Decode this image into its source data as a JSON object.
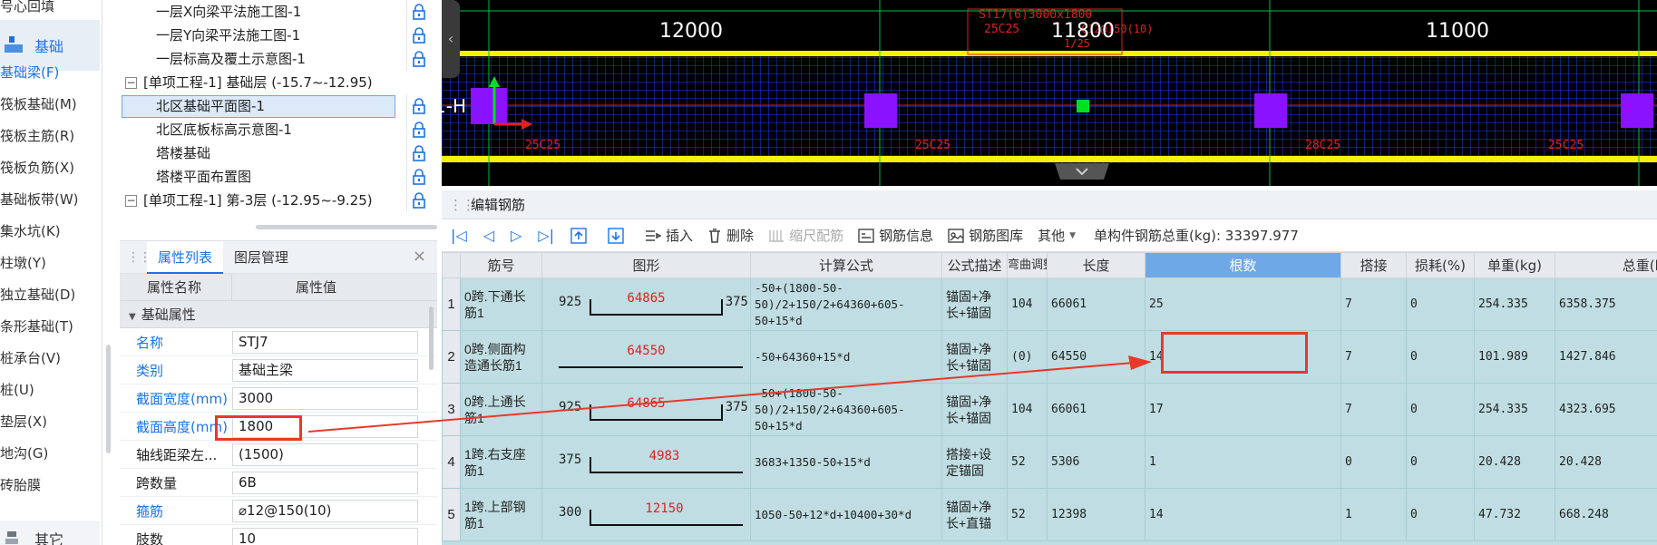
{
  "sidebar": {
    "items": [
      {
        "label": "号心回填"
      },
      {
        "label": "基础梁(F)",
        "active": true
      },
      {
        "label": "筏板基础(M)"
      },
      {
        "label": "筏板主筋(R)"
      },
      {
        "label": "筏板负筋(X)"
      },
      {
        "label": "基础板带(W)"
      },
      {
        "label": "集水坑(K)"
      },
      {
        "label": "柱墩(Y)"
      },
      {
        "label": "独立基础(D)"
      },
      {
        "label": "条形基础(T)"
      },
      {
        "label": "桩承台(V)"
      },
      {
        "label": "桩(U)"
      },
      {
        "label": "垫层(X)"
      },
      {
        "label": "地沟(G)"
      },
      {
        "label": "砖胎膜"
      }
    ],
    "group_foundation": "基础",
    "group_other": "其它"
  },
  "tree": {
    "rows": [
      {
        "label": "一层X向梁平法施工图-1",
        "indent": 1
      },
      {
        "label": "一层Y向梁平法施工图-1",
        "indent": 1
      },
      {
        "label": "一层标高及覆土示意图-1",
        "indent": 1
      },
      {
        "label": "[单项工程-1] 基础层 (-15.7~-12.95)",
        "indent": 0,
        "expander": "−"
      },
      {
        "label": "北区基础平面图-1",
        "indent": 1,
        "selected": true
      },
      {
        "label": "北区底板标高示意图-1",
        "indent": 1
      },
      {
        "label": "塔楼基础",
        "indent": 1
      },
      {
        "label": "塔楼平面布置图",
        "indent": 1
      },
      {
        "label": "[单项工程-1] 第-3层 (-12.95~-9.25)",
        "indent": 0,
        "expander": "−"
      }
    ]
  },
  "props": {
    "tab_active": "属性列表",
    "tab_inactive": "图层管理",
    "close": "×",
    "head_name": "属性名称",
    "head_value": "属性值",
    "group": "基础属性",
    "rows": [
      {
        "name": "名称",
        "value": "STJ7",
        "blue": true
      },
      {
        "name": "类别",
        "value": "基础主梁",
        "blue": true
      },
      {
        "name": "截面宽度(mm)",
        "value": "3000",
        "blue": true
      },
      {
        "name": "截面高度(mm)",
        "value": "1800",
        "blue": true
      },
      {
        "name": "轴线距梁左...",
        "value": "(1500)",
        "blue": false
      },
      {
        "name": "跨数量",
        "value": "6B",
        "blue": false
      },
      {
        "name": "箍筋",
        "value": "⌀12@150(10)",
        "blue": true
      },
      {
        "name": "肢数",
        "value": "10",
        "blue": false
      }
    ]
  },
  "cad": {
    "dims": [
      "12000",
      "11800",
      "11000"
    ],
    "axis_label": "1-H",
    "annotation_top": "ST17(6)3000x1800",
    "annotation_mid": "25C25",
    "annotation_mid2": "C12@150(10)",
    "annotation_mid3": "1/25",
    "beam_labels": [
      "25C25",
      "25C25",
      "28C25",
      "25C25"
    ]
  },
  "editor": {
    "title": "编辑钢筋",
    "toolbar": {
      "insert": "插入",
      "delete": "删除",
      "scale_rebar": "缩尺配筋",
      "rebar_info": "钢筋信息",
      "rebar_lib": "钢筋图库",
      "other": "其他",
      "total": "单构件钢筋总重(kg): 33397.977"
    },
    "columns": [
      "",
      "筋号",
      "图形",
      "计算公式",
      "公式描述",
      "弯曲调整",
      "长度",
      "根数",
      "搭接",
      "损耗(%)",
      "单重(kg)",
      "总重(k"
    ],
    "rows": [
      {
        "idx": "1",
        "name": "0跨.下通长筋1",
        "shape_left": "925",
        "shape_mid": "64865",
        "shape_right": "375",
        "shape_type": "u",
        "formula": "-50+(1800-50-50)/2+150/2+64360+605-50+15*d",
        "desc": "锚固+净长+锚固",
        "bend": "104",
        "length": "66061",
        "count": "25",
        "lap": "7",
        "loss": "0",
        "unit": "254.335",
        "total": "6358.375"
      },
      {
        "idx": "2",
        "name": "0跨.侧面构造通长筋1",
        "shape_left": "",
        "shape_mid": "64550",
        "shape_right": "",
        "shape_type": "flat",
        "formula": "-50+64360+15*d",
        "desc": "锚固+净长+锚固",
        "bend": "(0)",
        "length": "64550",
        "count": "14",
        "lap": "7",
        "loss": "0",
        "unit": "101.989",
        "total": "1427.846"
      },
      {
        "idx": "3",
        "name": "0跨.上通长筋1",
        "shape_left": "925",
        "shape_mid": "64865",
        "shape_right": "375",
        "shape_type": "u",
        "formula": "-50+(1800-50-50)/2+150/2+64360+605-50+15*d",
        "desc": "锚固+净长+锚固",
        "bend": "104",
        "length": "66061",
        "count": "17",
        "lap": "7",
        "loss": "0",
        "unit": "254.335",
        "total": "4323.695"
      },
      {
        "idx": "4",
        "name": "1跨.右支座筋1",
        "shape_left": "375",
        "shape_mid": "4983",
        "shape_right": "",
        "shape_type": "l",
        "formula": "3683+1350-50+15*d",
        "desc": "搭接+设定锚固",
        "bend": "52",
        "length": "5306",
        "count": "1",
        "lap": "0",
        "loss": "0",
        "unit": "20.428",
        "total": "20.428"
      },
      {
        "idx": "5",
        "name": "1跨.上部钢筋1",
        "shape_left": "300",
        "shape_mid": "12150",
        "shape_right": "",
        "shape_type": "l",
        "formula": "1050-50+12*d+10400+30*d",
        "desc": "锚固+净长+直锚",
        "bend": "52",
        "length": "12398",
        "count": "14",
        "lap": "1",
        "loss": "0",
        "unit": "47.732",
        "total": "668.248"
      }
    ]
  },
  "colors": {
    "accent": "#1a73e8",
    "annotation_red": "#e8392a",
    "grid_row": "#bfdde2",
    "cad_blue": "#1e3cff",
    "cad_yellow": "#f2f20a",
    "cad_purple": "#8a12ff"
  }
}
